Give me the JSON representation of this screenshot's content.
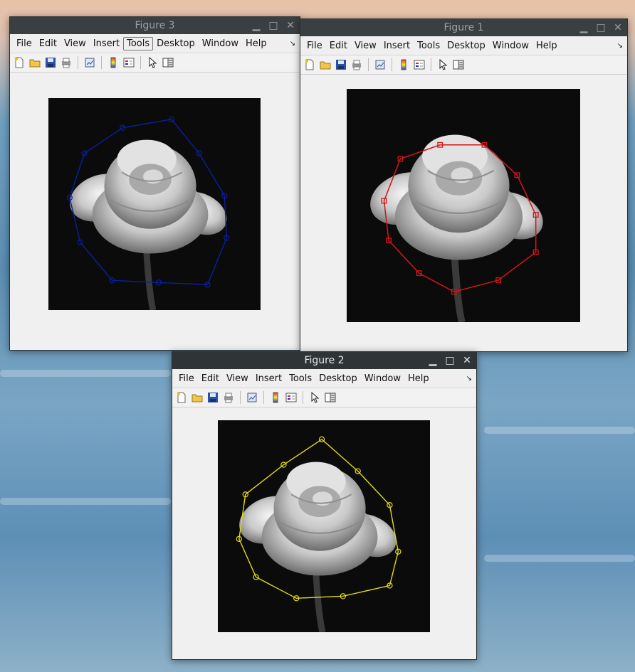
{
  "desktop": {
    "background": "ocean-waves-wallpaper"
  },
  "menus": [
    "File",
    "Edit",
    "View",
    "Insert",
    "Tools",
    "Desktop",
    "Window",
    "Help"
  ],
  "toolbar_icons": [
    "new-figure-icon",
    "open-file-icon",
    "save-icon",
    "print-icon",
    "link-plot-icon",
    "colorbar-icon",
    "legend-icon",
    "pointer-icon",
    "property-editor-icon"
  ],
  "windows": {
    "figure3": {
      "title": "Figure 3",
      "active": false,
      "selected_menu": "Tools",
      "polygon_color": "#0b1f9e",
      "marker": "circle"
    },
    "figure1": {
      "title": "Figure 1",
      "active": false,
      "selected_menu": "",
      "polygon_color": "#d41414",
      "marker": "square"
    },
    "figure2": {
      "title": "Figure 2",
      "active": true,
      "selected_menu": "",
      "polygon_color": "#e0dc10",
      "marker": "circle"
    }
  },
  "controls": {
    "minimize": "▁",
    "maximize": "□",
    "close": "✕"
  },
  "overflow_arrow": "↘"
}
